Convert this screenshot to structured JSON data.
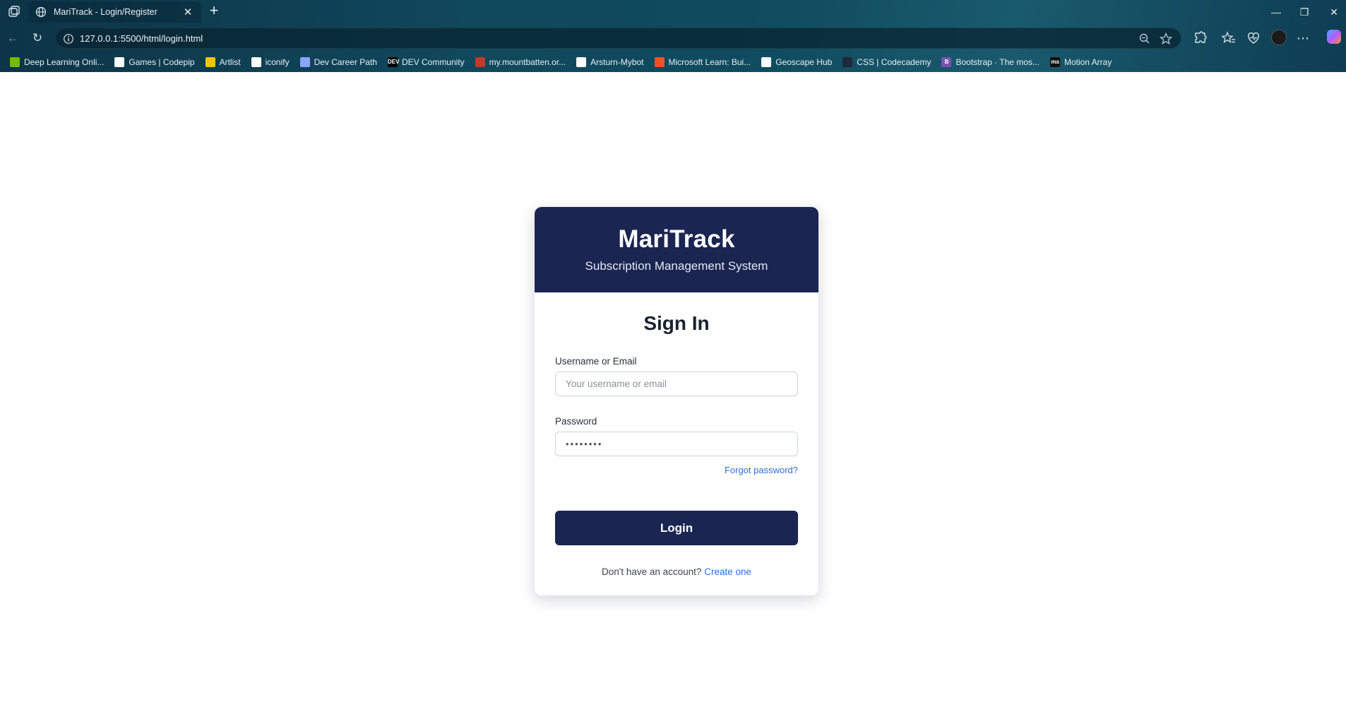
{
  "browser": {
    "tab": {
      "title": "MariTrack - Login/Register",
      "close": "✕"
    },
    "new_tab": "+",
    "window_controls": {
      "minimize": "—",
      "restore": "❐",
      "close": "✕"
    },
    "nav": {
      "back": "←",
      "reload": "↻"
    },
    "url": "127.0.0.1:5500/html/login.html",
    "omnibox_icons": {
      "zoom": "zoom-out-icon",
      "favorite": "star-icon"
    },
    "toolbar_icons": [
      "extensions-icon",
      "favorites-icon",
      "browser-essentials-icon",
      "profile-icon",
      "more-icon",
      "copilot-icon"
    ],
    "more": "⋯",
    "bookmarks": [
      {
        "label": "Deep Learning Onli...",
        "icon": "nvidia-icon",
        "color": "#76b900",
        "glyph": ""
      },
      {
        "label": "Games | Codepip",
        "icon": "codepip-icon",
        "color": "#ffffff",
        "glyph": ""
      },
      {
        "label": "Artlist",
        "icon": "artlist-icon",
        "color": "#f5c400",
        "glyph": ""
      },
      {
        "label": "iconify",
        "icon": "iconify-icon",
        "color": "#ffffff",
        "glyph": ""
      },
      {
        "label": "Dev Career Path",
        "icon": "chart-icon",
        "color": "#8aa4ff",
        "glyph": ""
      },
      {
        "label": "DEV Community",
        "icon": "dev-icon",
        "color": "#000000",
        "glyph": "DEV"
      },
      {
        "label": "my.mountbatten.or...",
        "icon": "mountbatten-icon",
        "color": "#c0392b",
        "glyph": ""
      },
      {
        "label": "Arsturn-Mybot",
        "icon": "chat-icon",
        "color": "#ffffff",
        "glyph": ""
      },
      {
        "label": "Microsoft Learn: Bui...",
        "icon": "microsoft-icon",
        "color": "#f25022",
        "glyph": ""
      },
      {
        "label": "Geoscape Hub",
        "icon": "geoscape-icon",
        "color": "#ffffff",
        "glyph": ""
      },
      {
        "label": "CSS | Codecademy",
        "icon": "codecademy-icon",
        "color": "#1d2a3a",
        "glyph": ""
      },
      {
        "label": "Bootstrap · The mos...",
        "icon": "bootstrap-icon",
        "color": "#7952b3",
        "glyph": "B"
      },
      {
        "label": "Motion Array",
        "icon": "motion-array-icon",
        "color": "#111111",
        "glyph": "ma"
      }
    ]
  },
  "app": {
    "brand": "MariTrack",
    "tagline": "Subscription Management System",
    "heading": "Sign In",
    "username_label": "Username or Email",
    "username_placeholder": "Your username or email",
    "password_label": "Password",
    "password_value": "••••••••",
    "forgot": "Forgot password?",
    "login": "Login",
    "signup_prompt": "Don't have an account?",
    "signup_link": "Create one"
  },
  "colors": {
    "primary": "#1b2552",
    "link": "#2f6fd6"
  }
}
